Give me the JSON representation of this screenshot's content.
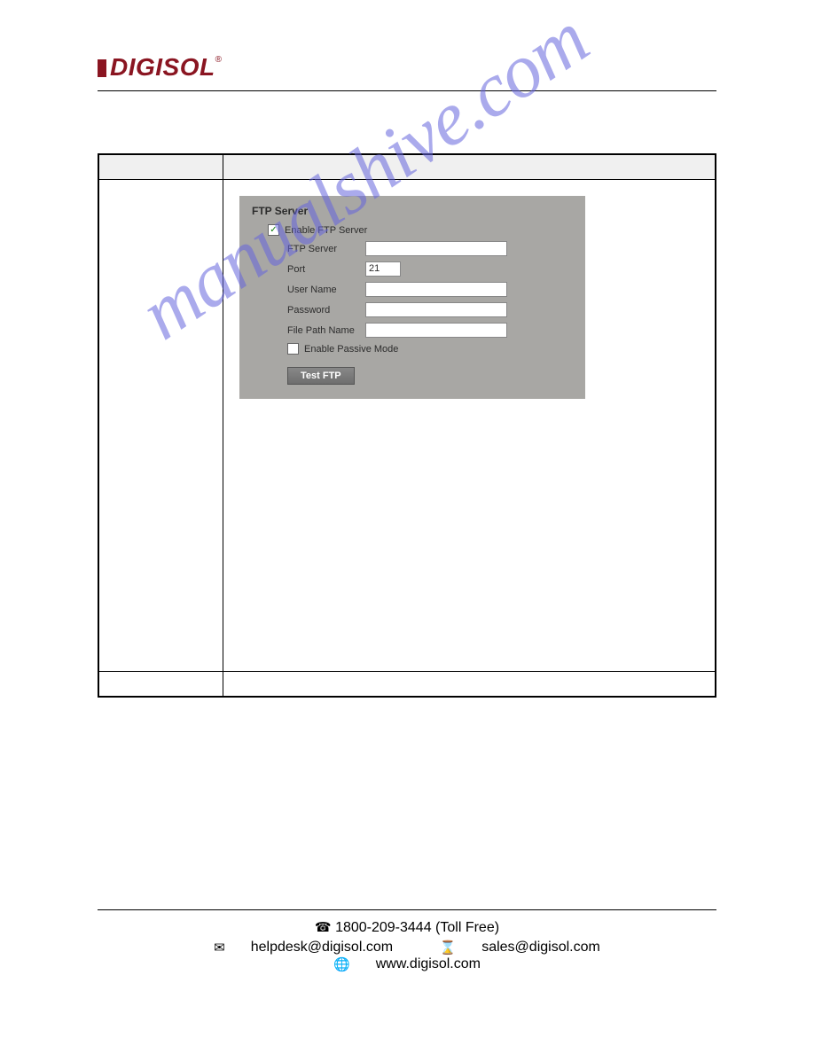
{
  "logo_text": "DIGISOL",
  "logo_tm": "®",
  "ftp_panel": {
    "title": "FTP Server",
    "enable_label": "Enable FTP Server",
    "enable_checked": true,
    "fields": {
      "server_label": "FTP Server",
      "server_value": "",
      "port_label": "Port",
      "port_value": "21",
      "user_label": "User Name",
      "user_value": "",
      "password_label": "Password",
      "password_value": "",
      "path_label": "File Path Name",
      "path_value": ""
    },
    "passive_label": "Enable Passive Mode",
    "passive_checked": false,
    "test_button": "Test FTP"
  },
  "watermark": "manualshive.com",
  "footer": {
    "phone": "1800-209-3444 (Toll Free)",
    "helpdesk": "helpdesk@digisol.com",
    "sales": "sales@digisol.com",
    "web": "www.digisol.com"
  }
}
